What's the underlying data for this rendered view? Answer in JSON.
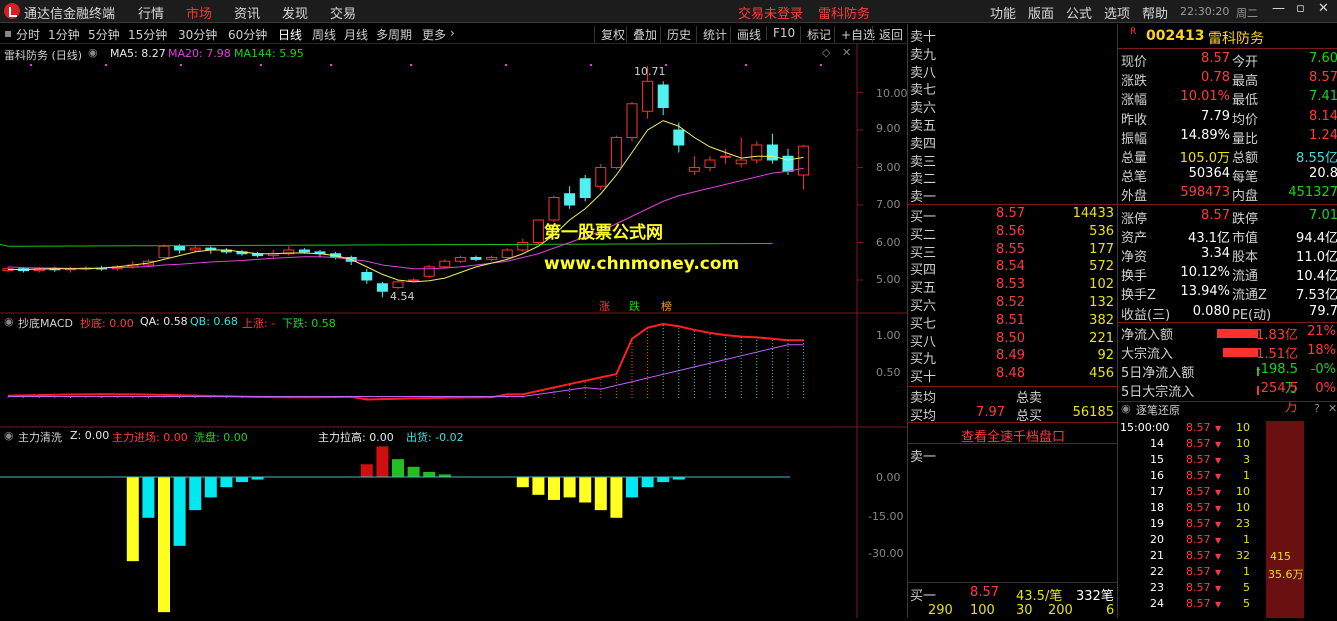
{
  "app": {
    "title": "通达信金融终端",
    "menu": [
      "行情",
      "市场",
      "资讯",
      "发现",
      "交易"
    ],
    "active_menu": "市场",
    "status": "交易未登录",
    "stock_tab": "雷科防务",
    "right_menu": [
      "功能",
      "版面",
      "公式",
      "选项",
      "帮助"
    ],
    "time": "22:30:20",
    "weekday": "周二"
  },
  "periods": [
    "分时",
    "1分钟",
    "5分钟",
    "15分钟",
    "30分钟",
    "60分钟",
    "日线",
    "周线",
    "月线",
    "多周期",
    "更多"
  ],
  "selected_period": "日线",
  "tools": [
    "复权",
    "叠加",
    "历史",
    "统计",
    "画线",
    "F10",
    "标记",
    "+自选",
    "返回"
  ],
  "main_pane": {
    "name": "雷科防务 (日线)",
    "ma5": "MA5: 8.27",
    "ma20": "MA20: 7.98",
    "ma144": "MA144: 5.95",
    "high_label": "10.71",
    "low_label": "4.54",
    "watermark1": "第一股票公式网",
    "watermark2": "www.chnmoney.com",
    "badges": [
      "涨",
      "跌",
      "榜"
    ],
    "y_ticks": [
      "10.00",
      "9.00",
      "8.00",
      "7.00",
      "6.00",
      "5.00"
    ]
  },
  "macd_pane": {
    "name": "抄底MACD",
    "chaodi": "抄底: 0.00",
    "qa": "QA: 0.58",
    "qb": "QB: 0.68",
    "up": "上涨: -",
    "down": "下跌: 0.58",
    "y_ticks": [
      "1.00",
      "0.50"
    ]
  },
  "zl_pane": {
    "name": "主力清洗",
    "z": "Z: 0.00",
    "jinchang": "主力进场: 0.00",
    "xipan": "洗盘: 0.00",
    "lagao": "主力拉高: 0.00",
    "chuhuo": "出货: -0.02",
    "y_ticks": [
      "0.00",
      "-15.00",
      "-30.00"
    ]
  },
  "order_book": {
    "asks": [
      {
        "label": "卖十"
      },
      {
        "label": "卖九"
      },
      {
        "label": "卖八"
      },
      {
        "label": "卖七"
      },
      {
        "label": "卖六"
      },
      {
        "label": "卖五"
      },
      {
        "label": "卖四"
      },
      {
        "label": "卖三"
      },
      {
        "label": "卖二"
      },
      {
        "label": "卖一"
      }
    ],
    "bids": [
      {
        "label": "买一",
        "price": "8.57",
        "vol": "14433"
      },
      {
        "label": "买二",
        "price": "8.56",
        "vol": "536"
      },
      {
        "label": "买三",
        "price": "8.55",
        "vol": "177"
      },
      {
        "label": "买四",
        "price": "8.54",
        "vol": "572"
      },
      {
        "label": "买五",
        "price": "8.53",
        "vol": "102"
      },
      {
        "label": "买六",
        "price": "8.52",
        "vol": "132"
      },
      {
        "label": "买七",
        "price": "8.51",
        "vol": "382"
      },
      {
        "label": "买八",
        "price": "8.50",
        "vol": "221"
      },
      {
        "label": "买九",
        "price": "8.49",
        "vol": "92"
      },
      {
        "label": "买十",
        "price": "8.48",
        "vol": "456"
      }
    ],
    "avg_sell_label": "卖均",
    "total_sell_label": "总卖",
    "avg_buy_label": "买均",
    "avg_buy": "7.97",
    "total_buy_label": "总买",
    "total_buy": "56185",
    "full_depth_link": "查看全速千档盘口",
    "sell1_label": "卖一",
    "bottom": {
      "label": "买一",
      "price": "8.57",
      "per": "43.5/笔",
      "count": "332笔",
      "row": [
        "290",
        "100",
        "30",
        "200",
        "6"
      ]
    }
  },
  "stock": {
    "code": "002413",
    "name": "雷科防务",
    "badge": "R"
  },
  "quote_stats": [
    [
      "现价",
      "8.57",
      "red",
      "今开",
      "7.60",
      "grn"
    ],
    [
      "涨跌",
      "0.78",
      "red",
      "最高",
      "8.57",
      "red"
    ],
    [
      "涨幅",
      "10.01%",
      "red",
      "最低",
      "7.41",
      "grn"
    ],
    [
      "昨收",
      "7.79",
      "wht",
      "均价",
      "8.14",
      "red"
    ],
    [
      "振幅",
      "14.89%",
      "wht",
      "量比",
      "1.24",
      "red"
    ],
    [
      "总量",
      "105.0万",
      "yel",
      "总额",
      "8.55亿",
      "cyn"
    ],
    [
      "总笔",
      "50364",
      "wht",
      "每笔",
      "20.8",
      "wht"
    ],
    [
      "外盘",
      "598473",
      "red",
      "内盘",
      "451327",
      "grn"
    ],
    [
      "涨停",
      "8.57",
      "red",
      "跌停",
      "7.01",
      "grn"
    ],
    [
      "资产",
      "43.1亿",
      "wht",
      "市值",
      "94.4亿",
      "wht"
    ],
    [
      "净资",
      "3.34",
      "wht",
      "股本",
      "11.0亿",
      "wht"
    ],
    [
      "换手",
      "10.12%",
      "wht",
      "流通",
      "10.4亿",
      "wht"
    ],
    [
      "换手Z",
      "13.94%",
      "wht",
      "流通Z",
      "7.53亿",
      "wht"
    ],
    [
      "收益(三)",
      "0.080",
      "wht",
      "PE(动)",
      "79.7",
      "wht"
    ]
  ],
  "flows": [
    {
      "label": "净流入额",
      "value": "1.83亿",
      "pct": "21%",
      "bar": 0.9,
      "color": "red"
    },
    {
      "label": "大宗流入",
      "value": "1.51亿",
      "pct": "18%",
      "bar": 0.75,
      "color": "red"
    },
    {
      "label": "5日净流入额",
      "value": "-198.5万",
      "pct": "-0%",
      "bar": 0.02,
      "color": "grn"
    },
    {
      "label": "5日大宗流入",
      "value": "254.5万",
      "pct": "0%",
      "bar": 0.02,
      "color": "red"
    }
  ],
  "ticks_header": "逐笔还原",
  "ticks": [
    {
      "t": "15:00:00",
      "p": "8.57",
      "v": "10"
    },
    {
      "t": "14",
      "p": "8.57",
      "v": "10"
    },
    {
      "t": "15",
      "p": "8.57",
      "v": "3"
    },
    {
      "t": "16",
      "p": "8.57",
      "v": "1"
    },
    {
      "t": "17",
      "p": "8.57",
      "v": "10"
    },
    {
      "t": "18",
      "p": "8.57",
      "v": "10"
    },
    {
      "t": "19",
      "p": "8.57",
      "v": "23"
    },
    {
      "t": "20",
      "p": "8.57",
      "v": "1"
    },
    {
      "t": "21",
      "p": "8.57",
      "v": "32"
    },
    {
      "t": "22",
      "p": "8.57",
      "v": "1"
    },
    {
      "t": "23",
      "p": "8.57",
      "v": "5"
    },
    {
      "t": "24",
      "p": "8.57",
      "v": "5"
    }
  ],
  "tick_block": {
    "v1": "415",
    "v2": "35.6万"
  }
}
